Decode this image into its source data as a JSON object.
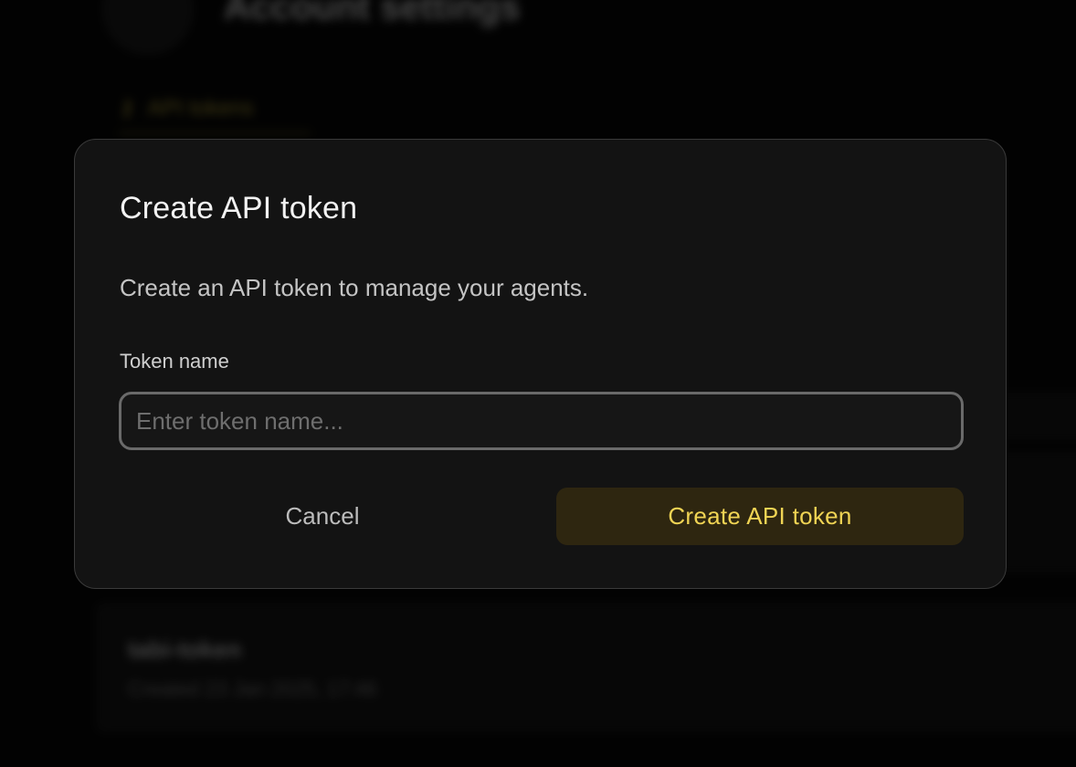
{
  "background": {
    "page_title": "Account settings",
    "tab_label": "API tokens",
    "token_name": "tabi-token",
    "token_created": "Created 23 Jan 2025, 17:46"
  },
  "dialog": {
    "title": "Create API token",
    "description": "Create an API token to manage your agents.",
    "field_label": "Token name",
    "field_placeholder": "Enter token name...",
    "field_value": "",
    "cancel_label": "Cancel",
    "submit_label": "Create API token"
  },
  "colors": {
    "accent": "#f0d454",
    "accent_bg": "#2e2610",
    "dialog_bg": "#131313"
  }
}
